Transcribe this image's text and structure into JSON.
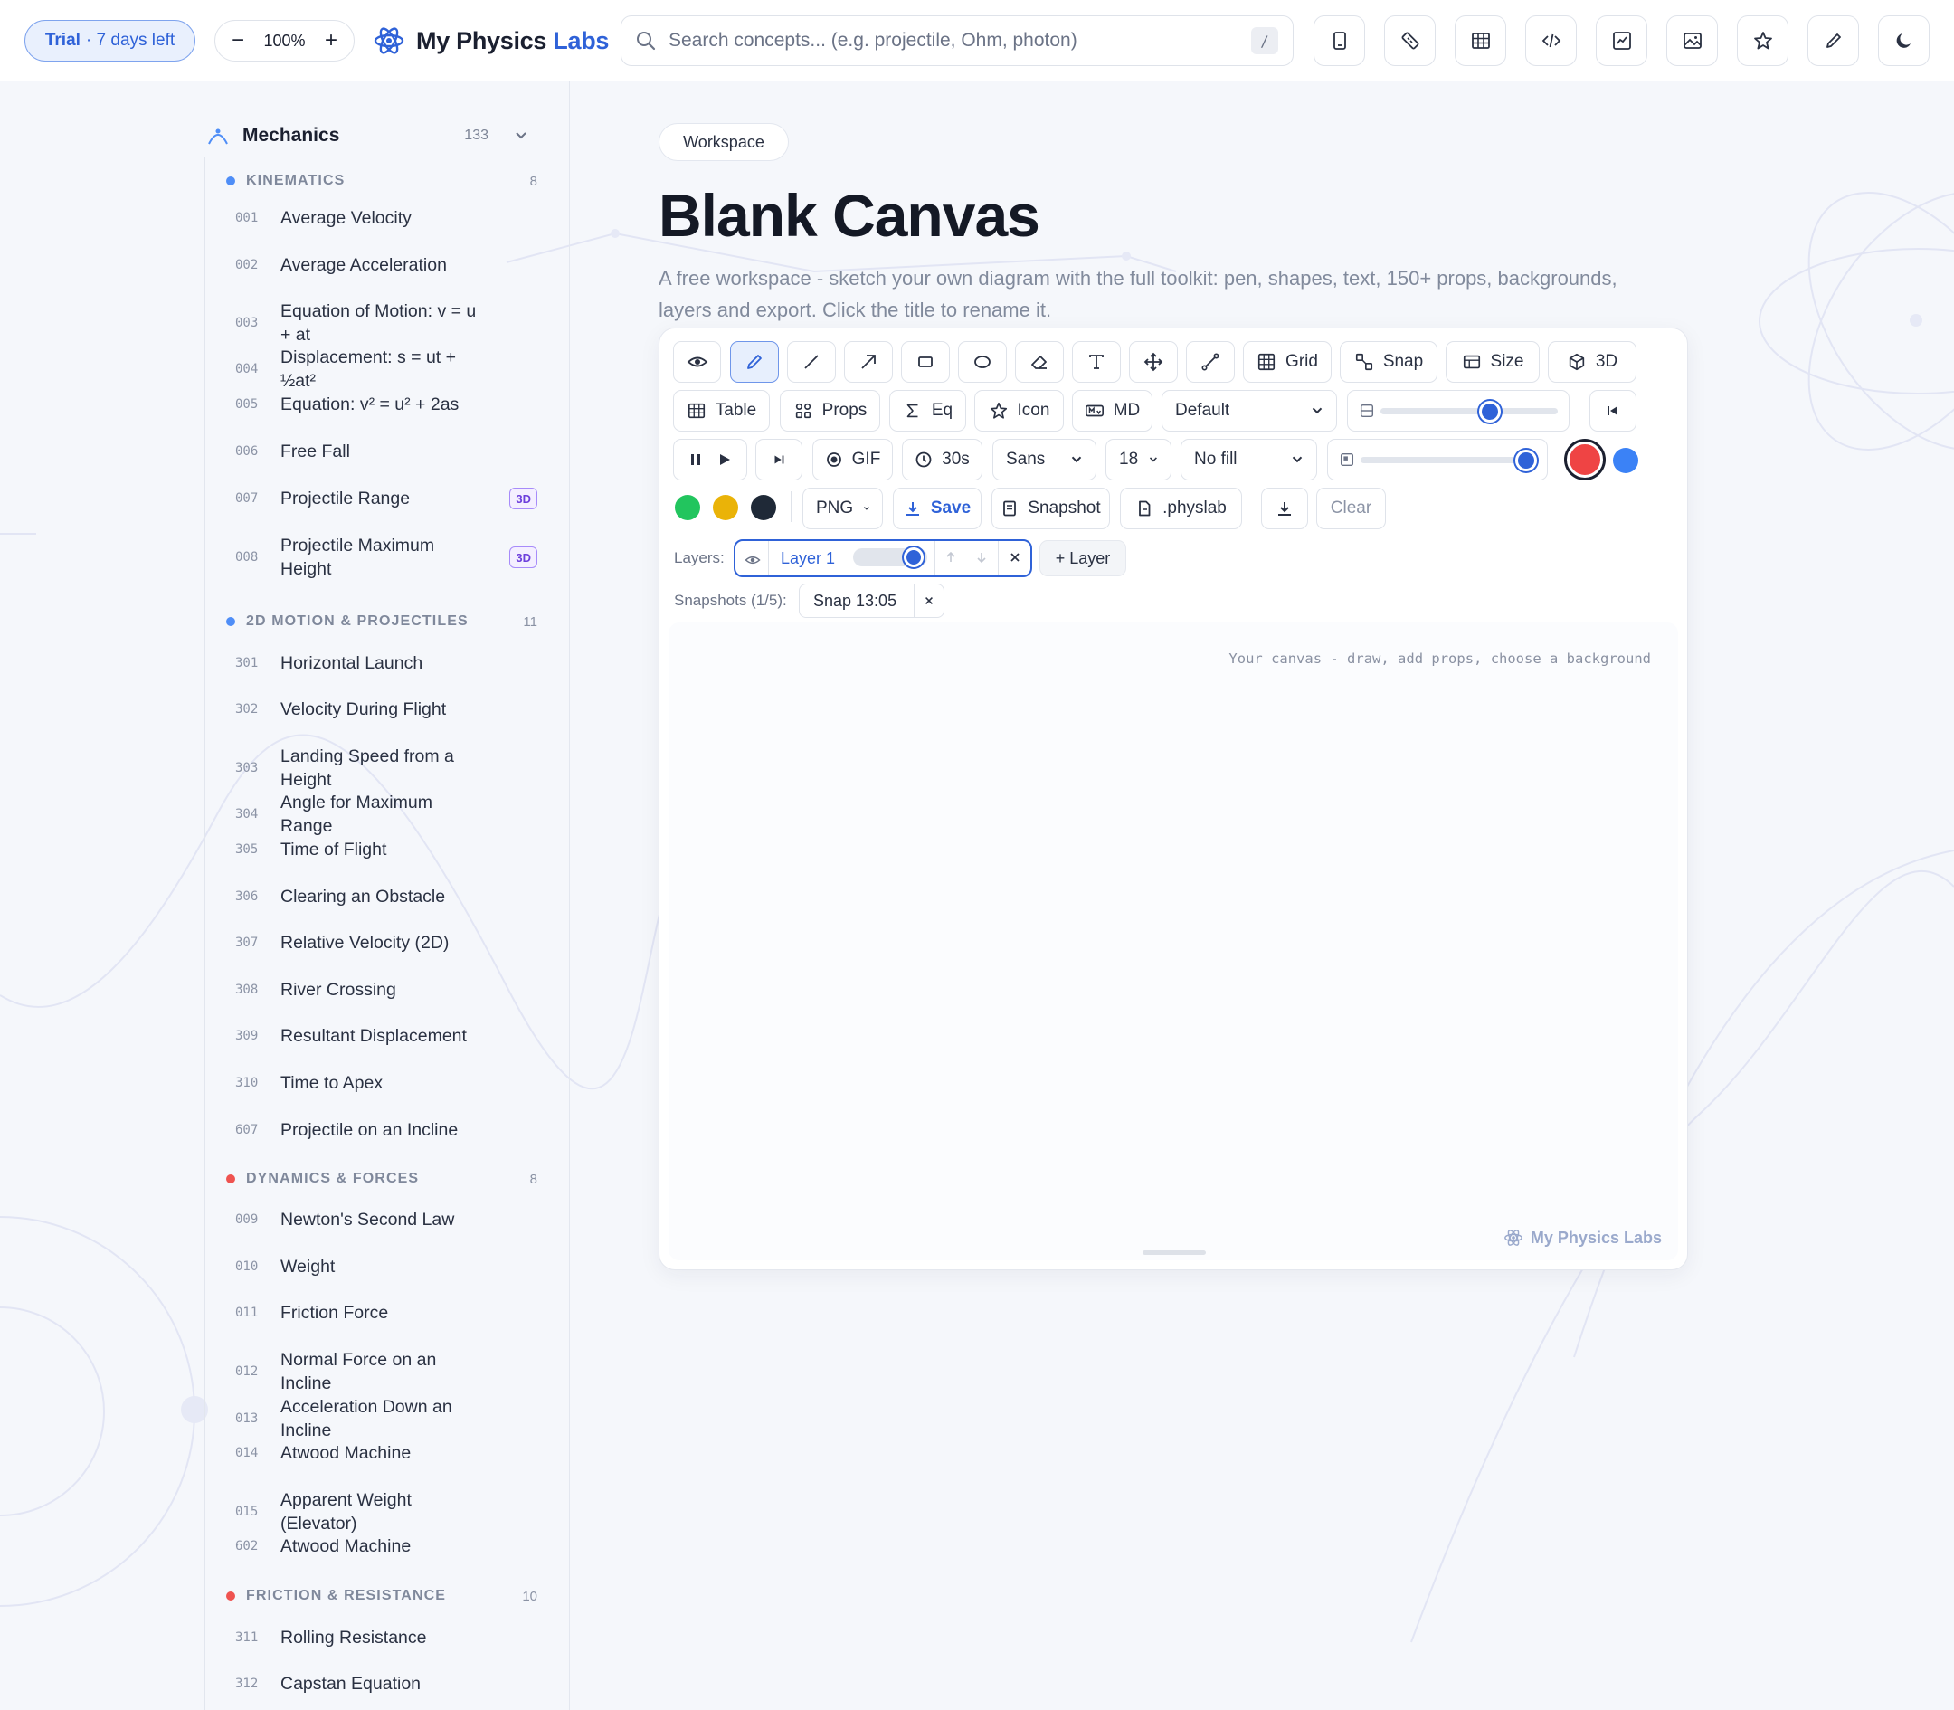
{
  "topbar": {
    "trial_bold": "Trial",
    "trial_rest": "· 7 days left",
    "zoom_minus": "−",
    "zoom_value": "100%",
    "zoom_plus": "+",
    "brand_main": "My Physics",
    "brand_accent": "Labs",
    "search_placeholder": "Search concepts...  (e.g. projectile, Ohm, photon)",
    "search_shortcut": "/",
    "tools": [
      "calculator-icon",
      "ruler-icon",
      "table-icon",
      "code-icon",
      "chart-icon",
      "image-icon",
      "star-icon",
      "pen-icon",
      "moon-icon"
    ]
  },
  "sidebar": {
    "section_title": "Mechanics",
    "section_count": "133",
    "groups": [
      {
        "label": "KINEMATICS",
        "count": "8",
        "dot": "#4f8ef7"
      },
      {
        "label": "2D MOTION & PROJECTILES",
        "count": "11",
        "dot": "#4f8ef7"
      },
      {
        "label": "DYNAMICS & FORCES",
        "count": "8",
        "dot": "#ef5350"
      },
      {
        "label": "FRICTION & RESISTANCE",
        "count": "10",
        "dot": "#ef5350"
      }
    ],
    "items": [
      {
        "num": "001",
        "label": "Average Velocity"
      },
      {
        "num": "002",
        "label": "Average Acceleration"
      },
      {
        "num": "003",
        "label": "Equation of Motion: v = u + at"
      },
      {
        "num": "004",
        "label": "Displacement: s = ut + ½at²"
      },
      {
        "num": "005",
        "label": "Equation: v² = u² + 2as"
      },
      {
        "num": "006",
        "label": "Free Fall"
      },
      {
        "num": "007",
        "label": "Projectile Range",
        "badge": "3D"
      },
      {
        "num": "008",
        "label": "Projectile Maximum Height",
        "badge": "3D"
      },
      {
        "num": "301",
        "label": "Horizontal Launch"
      },
      {
        "num": "302",
        "label": "Velocity During Flight"
      },
      {
        "num": "303",
        "label": "Landing Speed from a Height"
      },
      {
        "num": "304",
        "label": "Angle for Maximum Range"
      },
      {
        "num": "305",
        "label": "Time of Flight"
      },
      {
        "num": "306",
        "label": "Clearing an Obstacle"
      },
      {
        "num": "307",
        "label": "Relative Velocity (2D)"
      },
      {
        "num": "308",
        "label": "River Crossing"
      },
      {
        "num": "309",
        "label": "Resultant Displacement"
      },
      {
        "num": "310",
        "label": "Time to Apex"
      },
      {
        "num": "607",
        "label": "Projectile on an Incline"
      },
      {
        "num": "009",
        "label": "Newton's Second Law"
      },
      {
        "num": "010",
        "label": "Weight"
      },
      {
        "num": "011",
        "label": "Friction Force"
      },
      {
        "num": "012",
        "label": "Normal Force on an Incline"
      },
      {
        "num": "013",
        "label": "Acceleration Down an Incline"
      },
      {
        "num": "014",
        "label": "Atwood Machine"
      },
      {
        "num": "015",
        "label": "Apparent Weight (Elevator)"
      },
      {
        "num": "602",
        "label": "Atwood Machine"
      },
      {
        "num": "311",
        "label": "Rolling Resistance"
      },
      {
        "num": "312",
        "label": "Capstan Equation"
      }
    ]
  },
  "main": {
    "breadcrumb": "Workspace",
    "title": "Blank Canvas",
    "description": "A free workspace - sketch your own diagram with the full toolkit: pen, shapes, text, 150+ props, backgrounds, layers and export. Click the title to rename it."
  },
  "toolbar": {
    "grid": "Grid",
    "snap": "Snap",
    "size": "Size",
    "three_d": "3D",
    "table": "Table",
    "props": "Props",
    "eq": "Eq",
    "icon": "Icon",
    "md": "MD",
    "background_select": "Default",
    "gif": "GIF",
    "duration": "30s",
    "font_select": "Sans",
    "font_size_select": "18",
    "fill_select": "No fill",
    "export_format": "PNG",
    "save": "Save",
    "snapshot": "Snapshot",
    "physlab": ".physlab",
    "clear": "Clear",
    "colors": {
      "active": "#ef4444",
      "blue": "#3b82f6",
      "green": "#22c55e",
      "yellow": "#eab308",
      "dark": "#1f2937"
    },
    "layers_label": "Layers:",
    "layer_name": "Layer 1",
    "add_layer": "+ Layer",
    "snapshots_label": "Snapshots (1/5):",
    "snapshot_item": "Snap 13:05"
  },
  "canvas": {
    "hint": "Your canvas - draw, add props, choose a background",
    "watermark": "My Physics Labs"
  }
}
